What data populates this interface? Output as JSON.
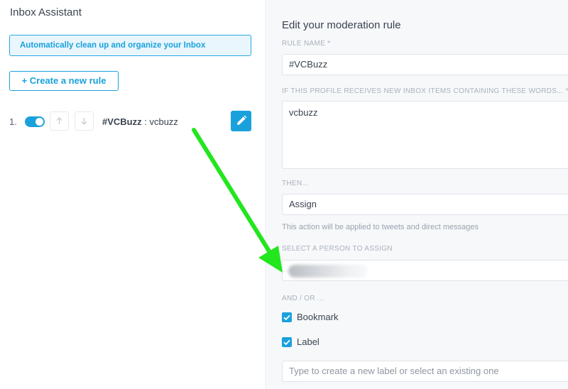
{
  "left": {
    "title": "Inbox Assistant",
    "banner": "Automatically clean up and organize your Inbox",
    "create_button": "+ Create a new rule",
    "rules": [
      {
        "number": "1.",
        "enabled": true,
        "name": "#VCBuzz",
        "separator": " : ",
        "keywords": "vcbuzz"
      }
    ],
    "icons": {
      "up": "arrow-up-icon",
      "down": "arrow-down-icon",
      "edit": "pencil-icon"
    }
  },
  "form": {
    "title": "Edit your moderation rule",
    "rule_name_label": "RULE NAME *",
    "rule_name_value": "#VCBuzz",
    "words_label": "IF THIS PROFILE RECEIVES NEW INBOX ITEMS CONTAINING THESE WORDS... *",
    "words_value": "vcbuzz",
    "then_label": "THEN...",
    "then_value": "Assign",
    "then_hint": "This action will be applied to tweets and direct messages",
    "assign_label": "SELECT A PERSON TO ASSIGN",
    "and_or_label": "AND / OR ...",
    "checkboxes": [
      {
        "label": "Bookmark",
        "checked": true
      },
      {
        "label": "Label",
        "checked": true
      }
    ],
    "label_placeholder": "Type to create a new label or select an existing one"
  },
  "colors": {
    "accent": "#1aa1dc",
    "annotation_arrow": "#22e61e"
  }
}
